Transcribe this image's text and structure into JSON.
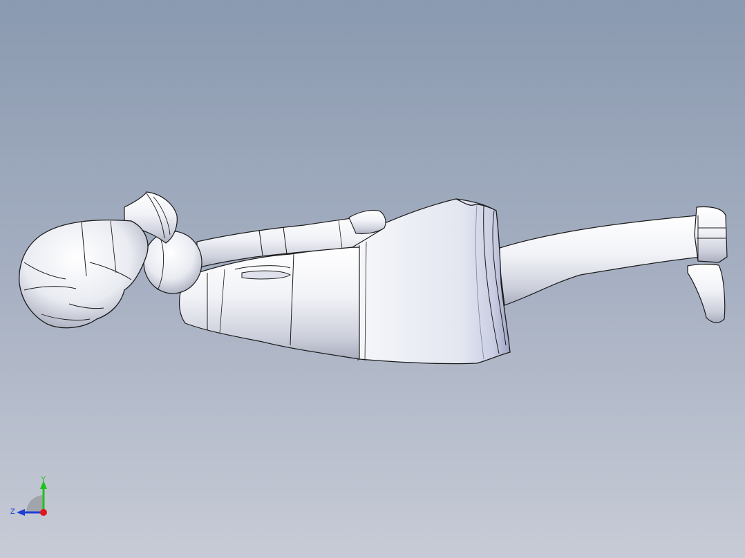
{
  "viewport": {
    "background_top": "#8a9ab0",
    "background_bottom": "#c7cbd6"
  },
  "model": {
    "icon": "figure-model",
    "body_color": "#eef0f6",
    "edge_color": "#1a1a1a"
  },
  "triad": {
    "y_label": "Y",
    "z_label": "Z",
    "y_color": "#1ec21e",
    "z_color": "#1f3fd6",
    "x_color": "#e0161b"
  }
}
